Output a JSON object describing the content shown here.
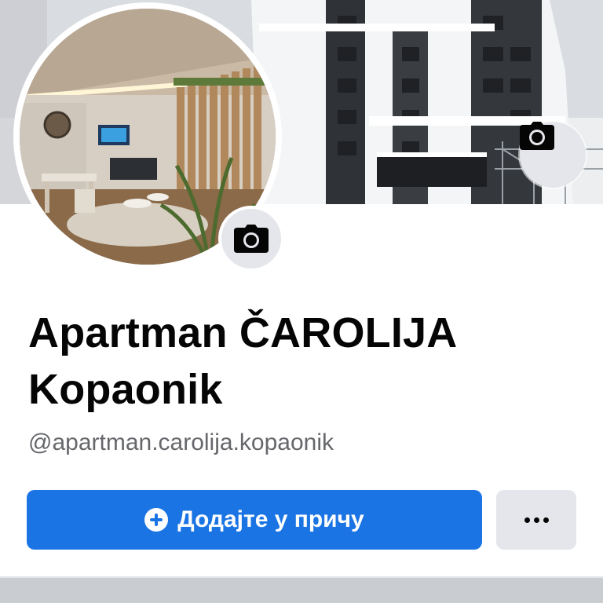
{
  "page": {
    "name": "Apartman ČAROLIJA Kopaonik",
    "username": "@apartman.carolija.kopaonik"
  },
  "actions": {
    "add_story_label": "Додајте у причу",
    "more_label": "…"
  },
  "icons": {
    "cover_camera": "camera-icon",
    "profile_camera": "camera-icon",
    "add_story": "plus-circle-icon",
    "more": "more-dots-icon"
  },
  "colors": {
    "primary_button": "#1b74e4",
    "secondary_button": "#e4e6eb",
    "text_primary": "#050505",
    "text_secondary": "#65676b"
  }
}
